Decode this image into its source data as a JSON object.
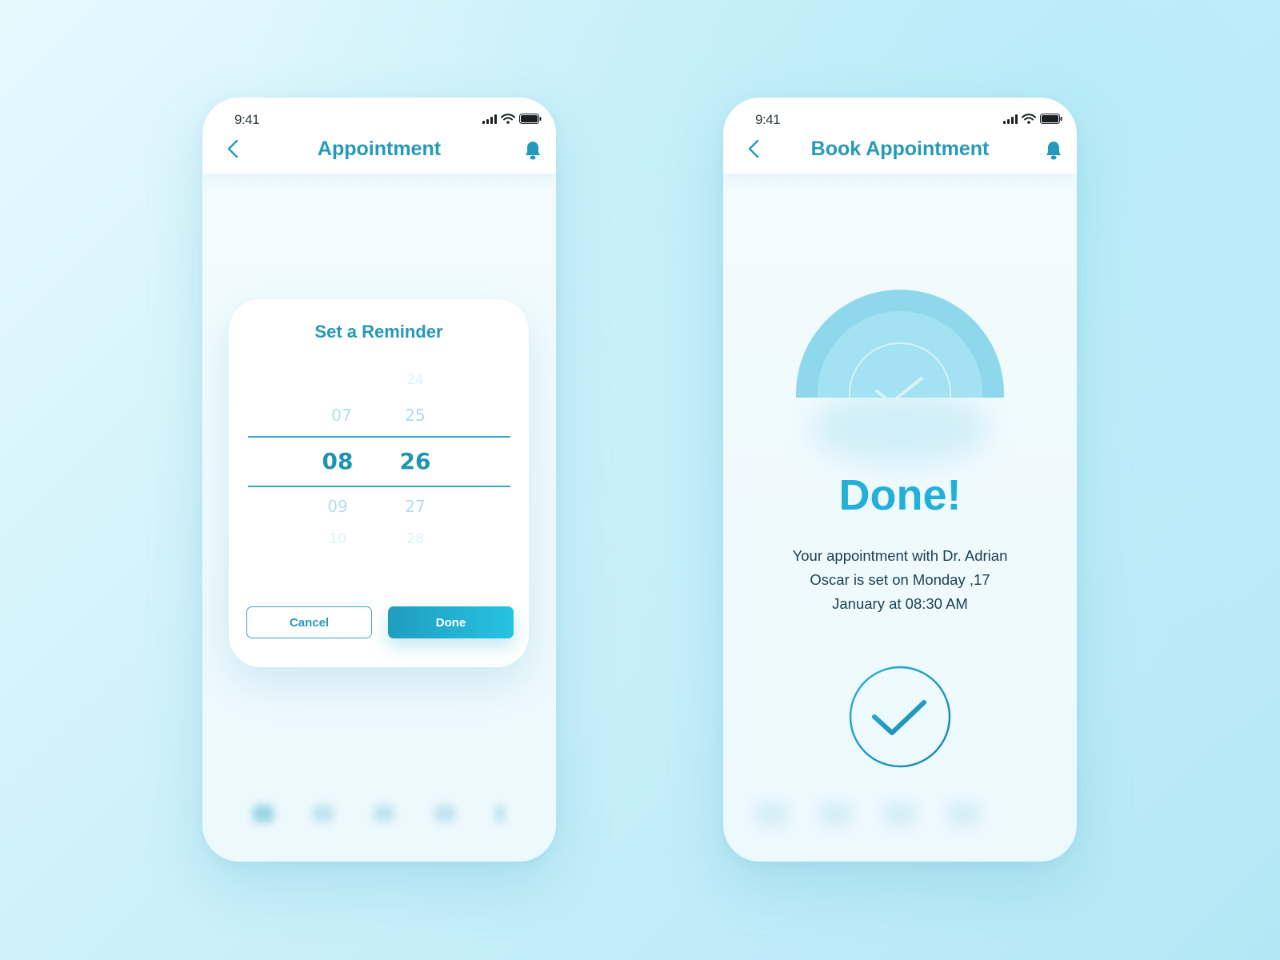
{
  "colors": {
    "accent": "#2599b9",
    "accent_light": "#27c2e3",
    "done_heading": "#22b0d9",
    "text_dark": "#1c3e52"
  },
  "left_screen": {
    "status_time": "9:41",
    "title": "Appointment",
    "icons": [
      "back-chevron-icon",
      "bell-icon",
      "signal-icon",
      "wifi-icon",
      "battery-icon"
    ],
    "modal": {
      "title": "Set a Reminder",
      "hours": [
        "07",
        "08",
        "09",
        "10"
      ],
      "minutes": [
        "24",
        "25",
        "26",
        "27",
        "28"
      ],
      "selected_hour": "08",
      "selected_minute": "26",
      "cancel_label": "Cancel",
      "done_label": "Done"
    },
    "bottom_nav_icons": [
      "home-icon",
      "folder-icon",
      "calendar-icon",
      "heart-icon",
      "profile-icon"
    ]
  },
  "right_screen": {
    "status_time": "9:41",
    "title": "Book Appointment",
    "icons": [
      "back-chevron-icon",
      "bell-icon",
      "checkmark-icon"
    ],
    "heading": "Done!",
    "message_lines": [
      "Your appointment with Dr. Adrian",
      "Oscar is set on Monday ,17",
      "January at 08:30 AM"
    ]
  }
}
